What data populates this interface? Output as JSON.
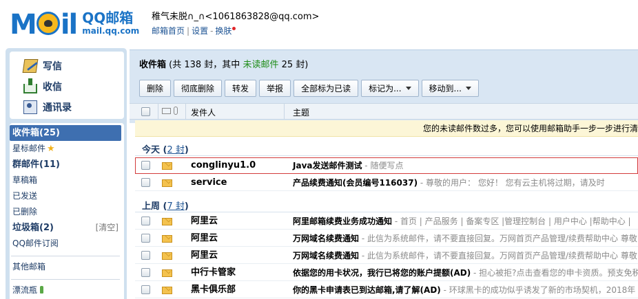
{
  "header": {
    "logo": {
      "word": "Mail",
      "brand": "QQ邮箱",
      "domain": "mail.qq.com"
    },
    "user_line": "稚气未脱∩_∩<1061863828@qq.com>",
    "links": {
      "home": "邮箱首页",
      "settings": "设置",
      "skin": "换肤"
    }
  },
  "sidebar": {
    "compose": {
      "write": "写信",
      "receive": "收信",
      "contacts": "通讯录"
    },
    "folders": [
      {
        "label": "收件箱(25)",
        "active": true
      },
      {
        "label": "星标邮件"
      },
      {
        "label": "群邮件(11)"
      },
      {
        "label": "草稿箱"
      },
      {
        "label": "已发送"
      },
      {
        "label": "已删除"
      },
      {
        "label": "垃圾箱(2)",
        "extra": "[清空]"
      },
      {
        "label": "QQ邮件订阅"
      },
      {
        "label": "其他邮箱"
      },
      {
        "label": "漂流瓶"
      }
    ]
  },
  "main": {
    "title": {
      "name": "收件箱",
      "prefix": " (共 138 封，其中 ",
      "unread": "未读邮件",
      "suffix": " 25 封)"
    },
    "toolbar": {
      "delete": "删除",
      "purge": "彻底删除",
      "forward": "转发",
      "report": "举报",
      "mark_all_read": "全部标为已读",
      "mark_as": "标记为...",
      "move_to": "移动到..."
    },
    "columns": {
      "sender": "发件人",
      "subject": "主题"
    },
    "notice": "您的未读邮件数过多，您可以使用邮箱助手一步一步进行清",
    "groups": [
      {
        "label": "今天",
        "count": "2 封",
        "rows": [
          {
            "sender": "conglinyu1.0",
            "subject": "Java发送邮件测试",
            "preview": " - 随便写点"
          },
          {
            "sender": "service",
            "subject": "产品续费通知(会员编号116037)",
            "preview": " - 尊敬的用户：     您好！     您有云主机将过期，请及时"
          }
        ]
      },
      {
        "label": "上周",
        "count": "7 封",
        "rows": [
          {
            "sender": "阿里云",
            "subject": "阿里邮箱续费业务成功通知",
            "preview": " - 首页 | 产品服务 | 备案专区 |管理控制台 | 用户中心 |帮助中心 |"
          },
          {
            "sender": "阿里云",
            "subject": "万网域名续费通知",
            "preview": " - 此信为系统邮件，请不要直接回复。万网首页产品管理/续费帮助中心 尊敬"
          },
          {
            "sender": "阿里云",
            "subject": "万网域名续费通知",
            "preview": " - 此信为系统邮件，请不要直接回复。万网首页产品管理/续费帮助中心 尊敬"
          },
          {
            "sender": "中行卡管家",
            "subject": "依据您的用卡状况，我行已将您的账户提额(AD)",
            "preview": " - 担心被拒?点击查看您的申卡资质。预支免税"
          },
          {
            "sender": "黑卡俱乐部",
            "subject": "你的黑卡申请表已到达邮箱,请了解(AD)",
            "preview": " - 环球黑卡的成功似乎诱发了新的市场契机，2018年"
          }
        ]
      }
    ]
  }
}
